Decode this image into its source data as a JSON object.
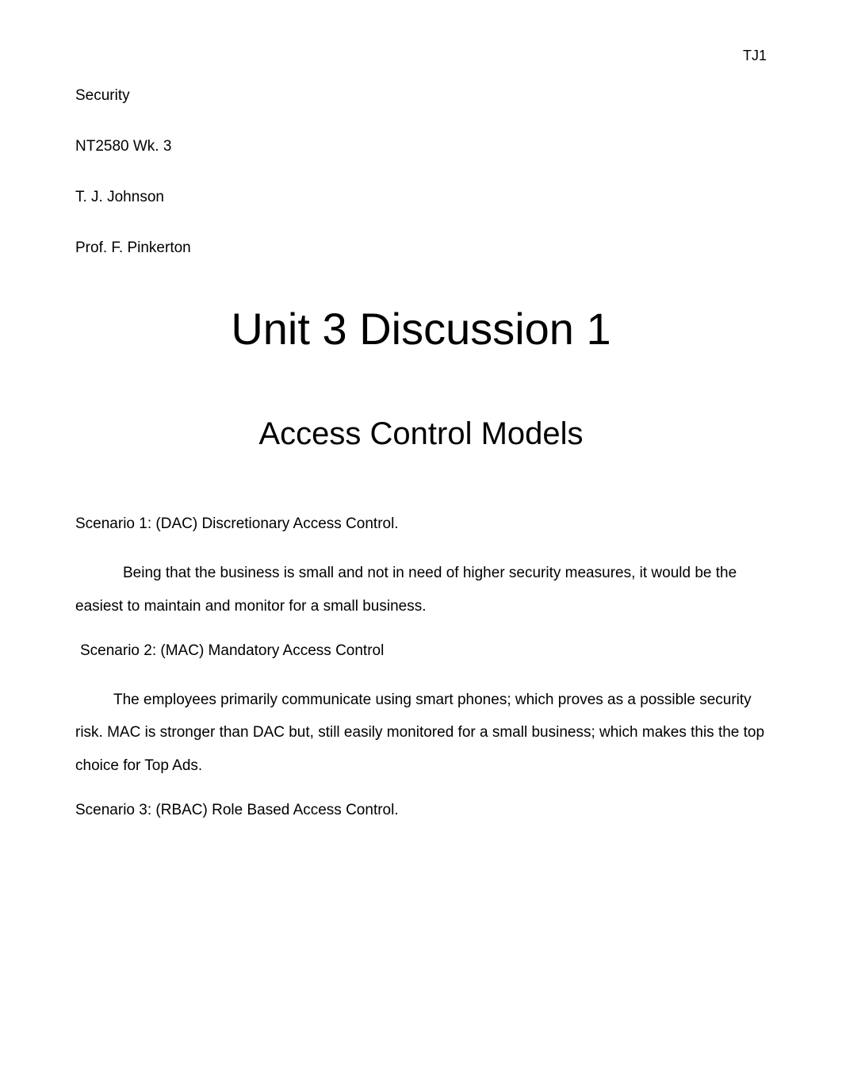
{
  "pageNumber": "TJ1",
  "header": {
    "line1": "Security",
    "line2": "NT2580 Wk. 3",
    "line3": "T. J. Johnson",
    "line4": "Prof. F. Pinkerton"
  },
  "title": "Unit 3 Discussion 1",
  "subtitle": "Access Control Models",
  "scenario1": {
    "heading": "Scenario 1: (DAC) Discretionary Access Control.",
    "body": " Being that the business is small and not in need of higher security measures, it would be the easiest to maintain and monitor for a small business."
  },
  "scenario2": {
    "heading": " Scenario 2: (MAC) Mandatory Access Control",
    "body": "The employees primarily communicate using smart phones; which proves as a possible security risk. MAC is stronger than DAC but, still easily monitored for a small business; which makes this the top choice for Top Ads."
  },
  "scenario3": {
    "heading": "Scenario 3: (RBAC) Role Based Access Control."
  }
}
